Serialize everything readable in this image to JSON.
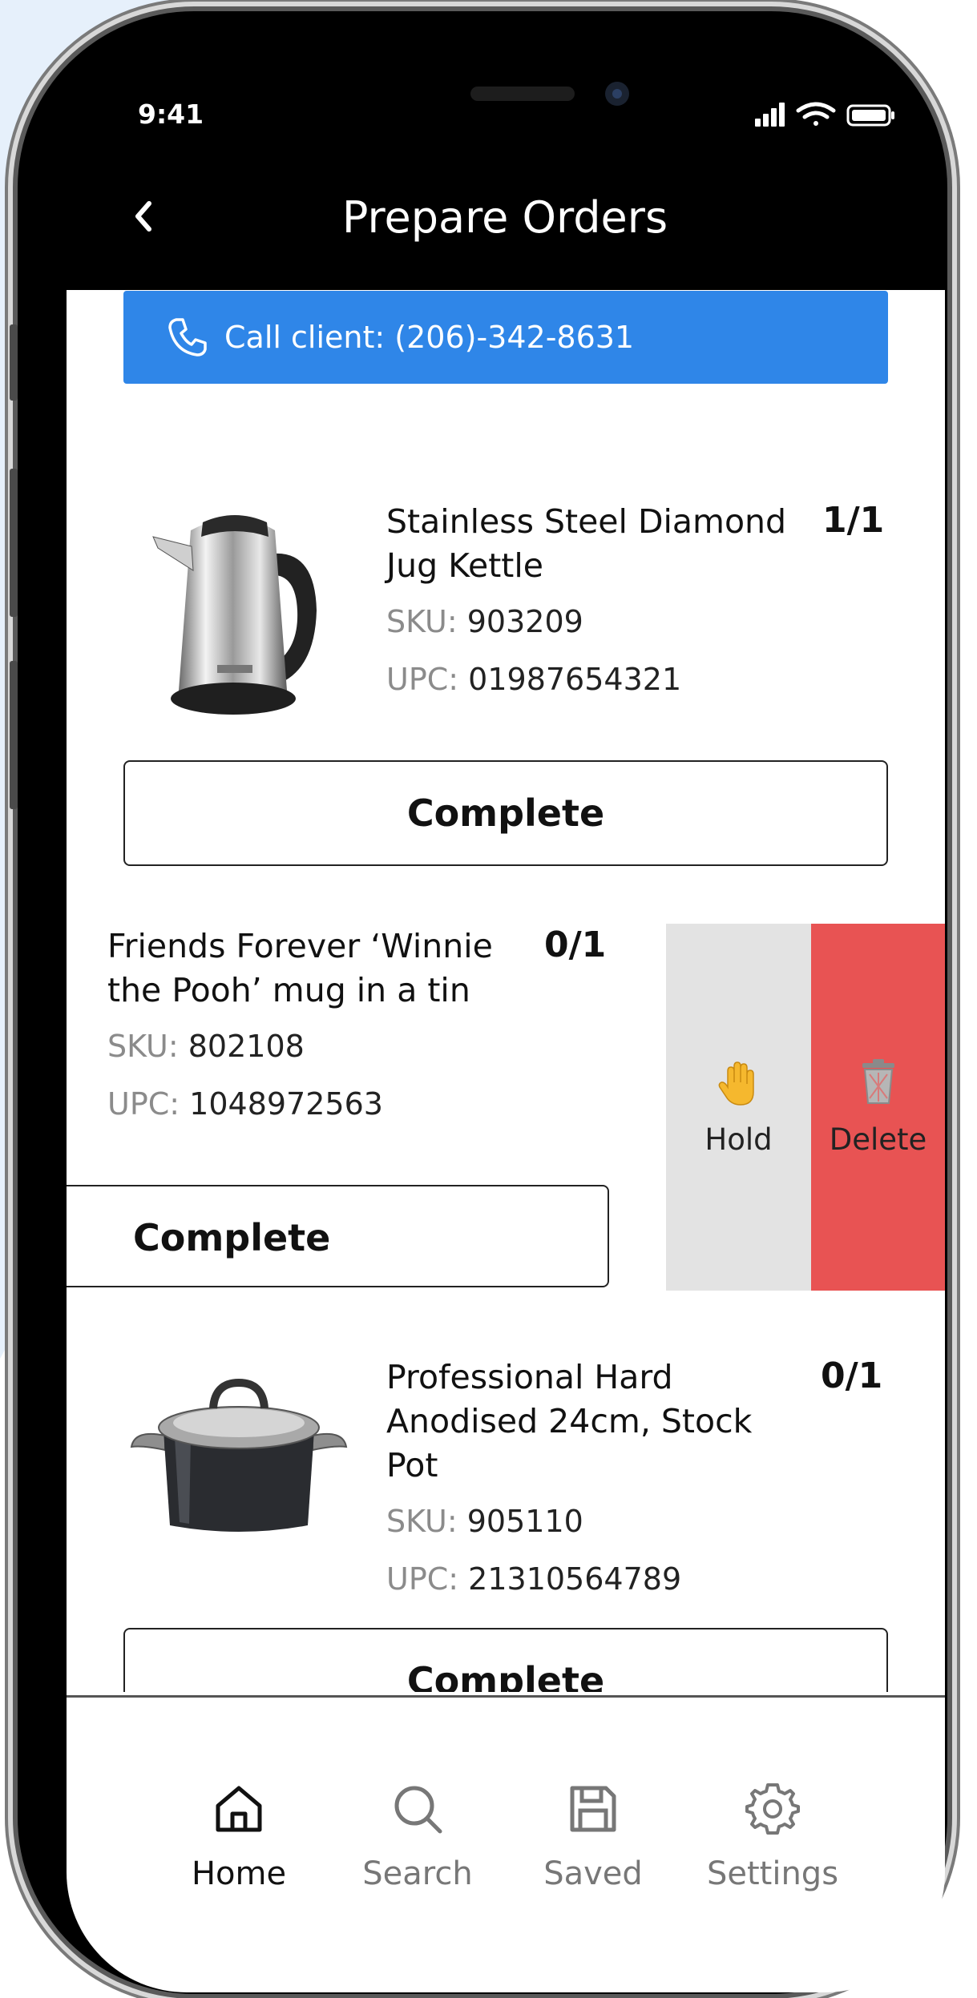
{
  "status_bar": {
    "time": "9:41"
  },
  "header": {
    "back_icon": "chevron-left-icon",
    "title": "Prepare Orders"
  },
  "call_banner": {
    "icon": "phone-icon",
    "text": "Call client: (206)-342-8631"
  },
  "items": [
    {
      "image": "kettle-image",
      "name_line1": "Stainless Steel Diamond",
      "name_line2": "Jug Kettle",
      "qty": "1/1",
      "sku_label": "SKU:",
      "sku": "903209",
      "upc_label": "UPC:",
      "upc": "01987654321",
      "button": "Complete"
    },
    {
      "name_line1": "Friends Forever ‘Winnie",
      "name_line2": "the Pooh’ mug in a tin",
      "qty": "0/1",
      "sku_label": "SKU:",
      "sku": "802108",
      "upc_label": "UPC:",
      "upc": "1048972563",
      "button": "Complete"
    },
    {
      "image": "stock-pot-image",
      "name_line1": "Professional Hard",
      "name_line2": "Anodised 24cm, Stock",
      "name_line3": "Pot",
      "qty": "0/1",
      "sku_label": "SKU:",
      "sku": "905110",
      "upc_label": "UPC:",
      "upc": "21310564789",
      "button": "Complete"
    }
  ],
  "swipe_actions": {
    "hold": {
      "label": "Hold",
      "icon": "raised-hand-icon",
      "color": "#e3e3e3"
    },
    "delete": {
      "label": "Delete",
      "icon": "trash-icon",
      "color": "#e85353"
    }
  },
  "tabs": [
    {
      "label": "Home",
      "icon": "home-icon",
      "active": true
    },
    {
      "label": "Search",
      "icon": "search-icon",
      "active": false
    },
    {
      "label": "Saved",
      "icon": "save-icon",
      "active": false
    },
    {
      "label": "Settings",
      "icon": "gear-icon",
      "active": false
    }
  ],
  "colors": {
    "accent": "#2f86e8",
    "delete": "#e85353",
    "background": "#e6f0fb"
  }
}
